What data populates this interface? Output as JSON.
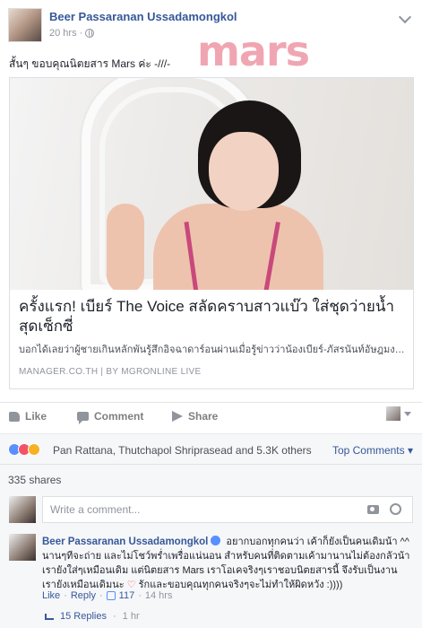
{
  "post": {
    "author": "Beer Passaranan Ussadamongkol",
    "time": "20 hrs",
    "separator": "·",
    "text": "สั้นๆ ขอบคุณนิตยสาร Mars ค่ะ -///-",
    "logo_text": "mars"
  },
  "link": {
    "title": "ครั้งแรก! เบียร์ The Voice สลัดคราบสาวแบ๊ว ใส่ชุดว่ายน้ำสุดเซ็กซี่",
    "description": "บอกได้เลยว่าผู้ชายเกินหลักพันรู้สึกอิจฉาดาร์อนผ่านเมื่อรู้ข่าวว่าน้องเบียร์-ภัสรนันท์อัษฎมงค...",
    "source": "MANAGER.CO.TH | BY MGRONLINE LIVE"
  },
  "actions": {
    "like": "Like",
    "comment": "Comment",
    "share": "Share"
  },
  "reactions": {
    "summary": "Pan Rattana, Thutchapol Shriprasead and 5.3K others",
    "sort": "Top Comments ▾"
  },
  "shares": "335 shares",
  "comment_box": {
    "placeholder": "Write a comment..."
  },
  "top_comment": {
    "author": "Beer Passaranan Ussadamongkol",
    "text_before_heart": "อยากบอกทุกคนว่า เค้าก็ยังเป็นคนเดิมน้า ^^ นานๆทีจะถ่าย และไม่โชว์พร่ำเพรื่อแน่นอน สำหรับคนที่ติดตามเค้ามานานไม่ต้องกลัวน้า เรายังใส่ๆเหมือนเดิม แต่นิตยสาร Mars เราโอเคจริงๆเราชอบนิตยสารนี้ จึงรับเป็นงาน เรายังเหมือนเดิมนะ",
    "heart": "♡",
    "text_after_heart": "รักและขอบคุณทุกคนจริงๆจะไม่ทำให้ผิดหวัง :))))",
    "like_link": "Like",
    "reply_link": "Reply",
    "dot": "·",
    "likes": "117",
    "time": "14 hrs",
    "replies": "15 Replies",
    "replies_time": "1 hr"
  }
}
